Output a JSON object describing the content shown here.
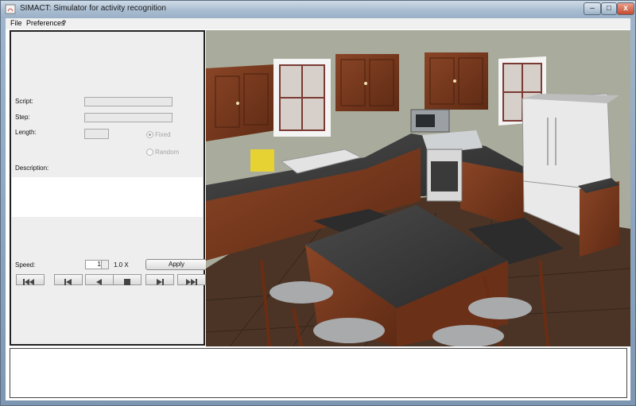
{
  "window": {
    "title": "SIMACT: Simulator for activity recognition",
    "minimize_label": "–",
    "maximize_label": "□",
    "close_label": "x"
  },
  "menu": {
    "items": [
      "File",
      "Preferences",
      "?"
    ]
  },
  "panel": {
    "script_label": "Script:",
    "step_label": "Step:",
    "length_label": "Length:",
    "fixed_label": "Fixed",
    "random_label": "Random",
    "description_label": "Description:",
    "speed_label": "Speed:",
    "speed_value": "1",
    "speed_multiplier": "1.0 X",
    "apply_label": "Apply"
  },
  "colors": {
    "titlebar": "#a9bdd1",
    "panel_bg": "#eeeeee",
    "wall": "#a8ab9b",
    "cabinet": "#7a3a20",
    "granite": "#3a3a3a",
    "floor": "#4a3424"
  },
  "icons": [
    "java-app-icon",
    "first-icon",
    "step-back-icon",
    "play-back-icon",
    "stop-icon",
    "play-icon",
    "last-icon"
  ]
}
